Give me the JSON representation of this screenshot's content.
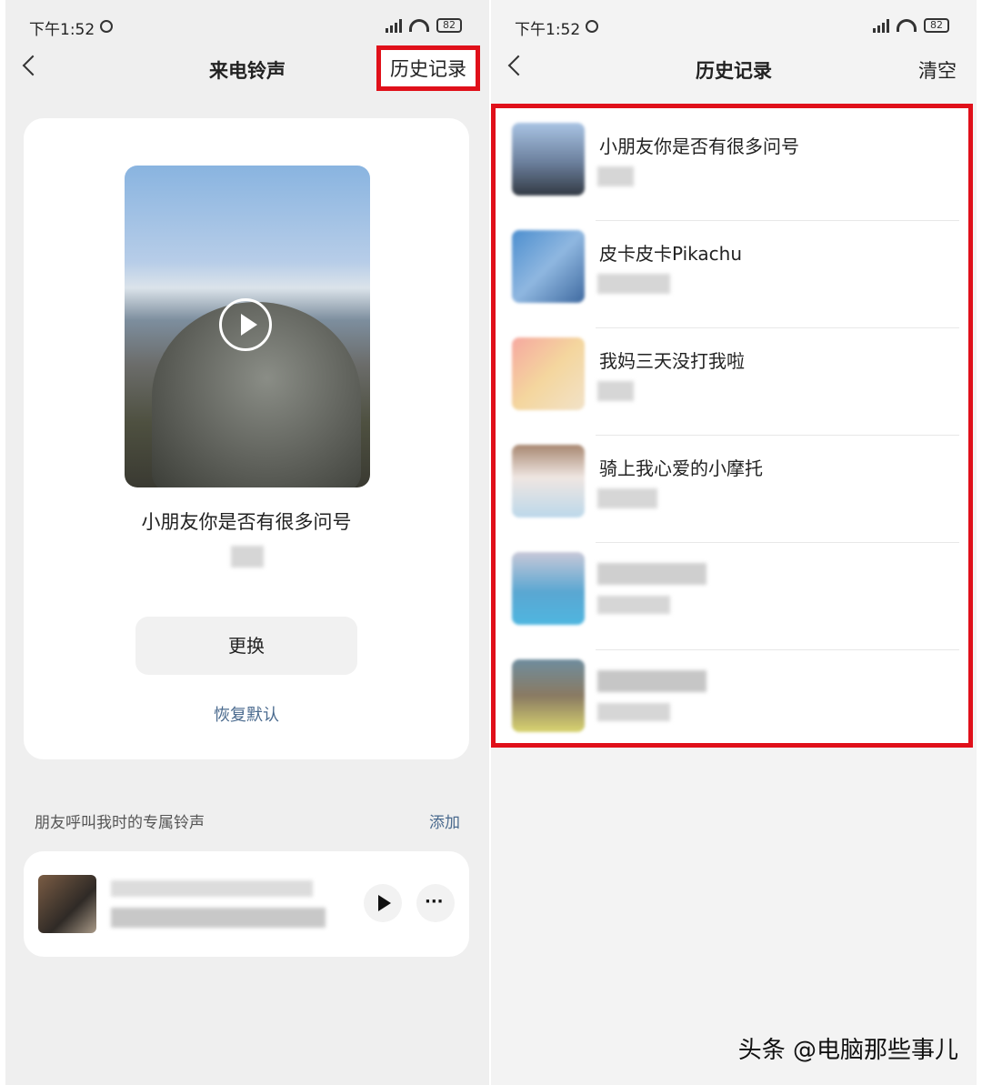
{
  "status_bar": {
    "time": "下午1:52",
    "battery": "82"
  },
  "left_screen": {
    "title": "来电铃声",
    "history_button": "历史记录",
    "current_ringtone": {
      "title": "小朋友你是否有很多问号"
    },
    "change_button": "更换",
    "restore_default": "恢复默认",
    "section_title": "朋友呼叫我时的专属铃声",
    "add_button": "添加"
  },
  "right_screen": {
    "title": "历史记录",
    "clear_button": "清空",
    "items": [
      {
        "title": "小朋友你是否有很多问号",
        "thumb_color": "#7f9fc4"
      },
      {
        "title": "皮卡皮卡Pikachu",
        "thumb_color": "#6aa0d4"
      },
      {
        "title": "我妈三天没打我啦",
        "thumb_color": "#f2c39a"
      },
      {
        "title": "骑上我心爱的小摩托",
        "thumb_color": "#d9c8c0"
      },
      {
        "title": "",
        "thumb_color": "#79a8c0"
      },
      {
        "title": "",
        "thumb_color": "#9a9a60"
      }
    ]
  },
  "watermark": "头条 @电脑那些事儿"
}
